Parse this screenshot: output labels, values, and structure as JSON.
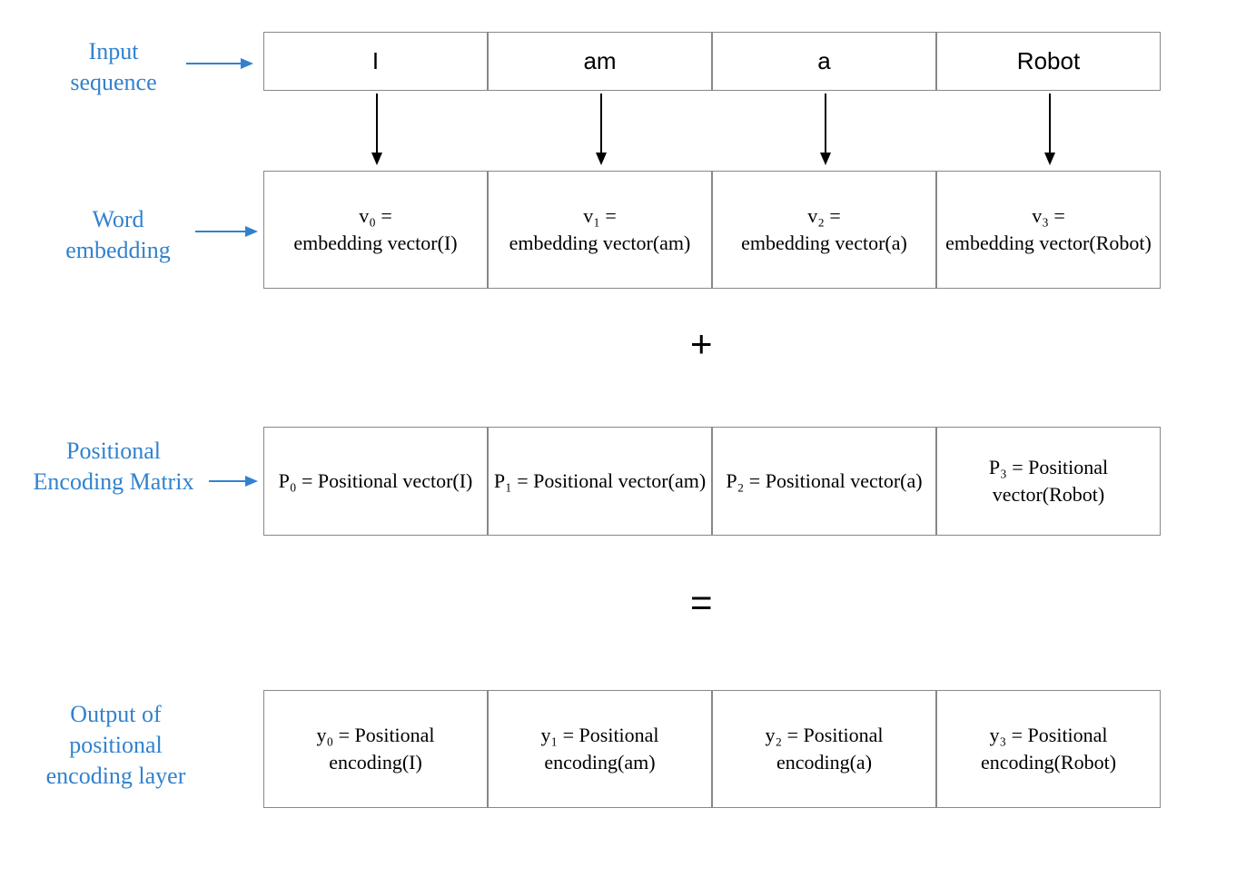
{
  "labels": {
    "input": "Input sequence",
    "word": "Word embedding",
    "pos": "Positional Encoding Matrix",
    "out": "Output of positional encoding layer"
  },
  "inputTokens": [
    "I",
    "am",
    "a",
    "Robot"
  ],
  "embed": {
    "v0a": "v₀ =",
    "v0b": "embedding vector(I)",
    "v1a": "v₁ =",
    "v1b": "embedding vector(am)",
    "v2a": "v₂ =",
    "v2b": "embedding vector(a)",
    "v3a": "v₃ =",
    "v3b": "embedding vector(Robot)"
  },
  "posenc": {
    "p0": "P₀ = Positional vector(I)",
    "p1": "P₁ = Positional vector(am)",
    "p2": "P₂ = Positional vector(a)",
    "p3": "P₃ = Positional vector(Robot)"
  },
  "output": {
    "y0": "y₀ = Positional encoding(I)",
    "y1": "y₁ = Positional encoding(am)",
    "y2": "y₂ = Positional encoding(a)",
    "y3": "y₃ = Positional encoding(Robot)"
  },
  "ops": {
    "plus": "+",
    "equals": "="
  }
}
